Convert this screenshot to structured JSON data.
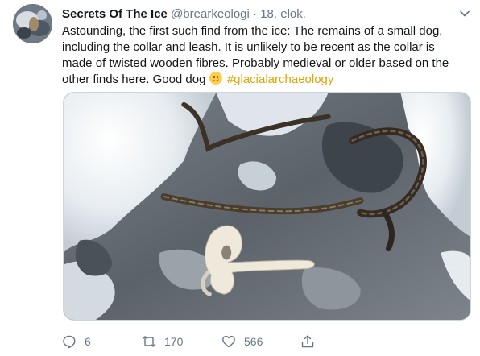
{
  "tweet": {
    "author_name": "Secrets Of The Ice",
    "handle": "@brearkeologi",
    "separator": "·",
    "date": "18. elok.",
    "text": "Astounding, the first such find from the ice: The remains of a small dog, including the collar and leash. It is unlikely to be recent as the collar is made of twisted wooden fibres. Probably medieval or older based on the other finds here. Good dog",
    "hashtag": "#glacialarchaeology",
    "hashtag_color": "#e0a400",
    "emoji": "slightly-smiling-face"
  },
  "actions": {
    "reply_count": "6",
    "retweet_count": "170",
    "like_count": "566",
    "reply_icon": "reply-icon",
    "retweet_icon": "retweet-icon",
    "like_icon": "heart-icon",
    "share_icon": "share-icon"
  },
  "colors": {
    "text": "#14171a",
    "muted": "#657786"
  }
}
